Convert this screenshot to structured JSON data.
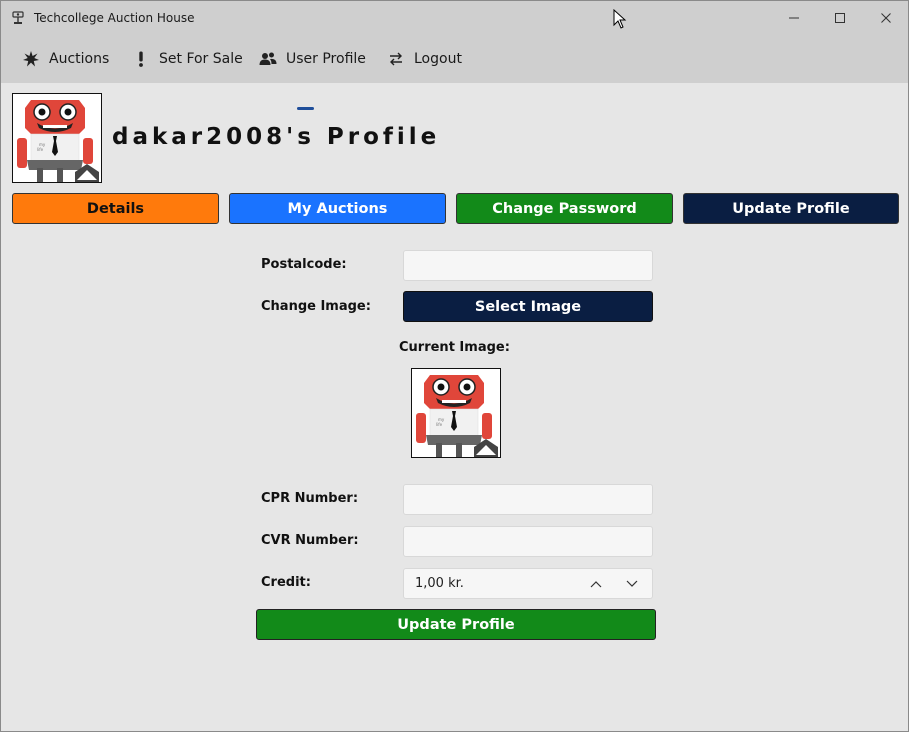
{
  "window": {
    "title": "Techcollege Auction House",
    "icon": "gavel-logo-icon"
  },
  "nav": {
    "items": [
      {
        "label": "Auctions",
        "icon": "explosion-star-icon"
      },
      {
        "label": "Set For Sale",
        "icon": "exclamation-icon"
      },
      {
        "label": "User Profile",
        "icon": "users-icon",
        "active": true
      },
      {
        "label": "Logout",
        "icon": "swap-arrows-icon"
      }
    ],
    "accent": "#1f4e9a"
  },
  "profile": {
    "title": "dakar2008's Profile",
    "avatar": "robot-avatar"
  },
  "tabs": [
    {
      "label": "Details",
      "color": "#ff7a0c"
    },
    {
      "label": "My Auctions",
      "color": "#1a73ff"
    },
    {
      "label": "Change Password",
      "color": "#128a19"
    },
    {
      "label": "Update Profile",
      "color": "#0a1e42"
    }
  ],
  "form": {
    "postalcode_label": "Postalcode:",
    "postalcode_value": "",
    "change_image_label": "Change Image:",
    "select_image_label": "Select Image",
    "current_image_label": "Current Image:",
    "cpr_label": "CPR Number:",
    "cpr_value": "",
    "cvr_label": "CVR Number:",
    "cvr_value": "",
    "credit_label": "Credit:",
    "credit_value": "1,00 kr.",
    "update_button": "Update Profile"
  }
}
